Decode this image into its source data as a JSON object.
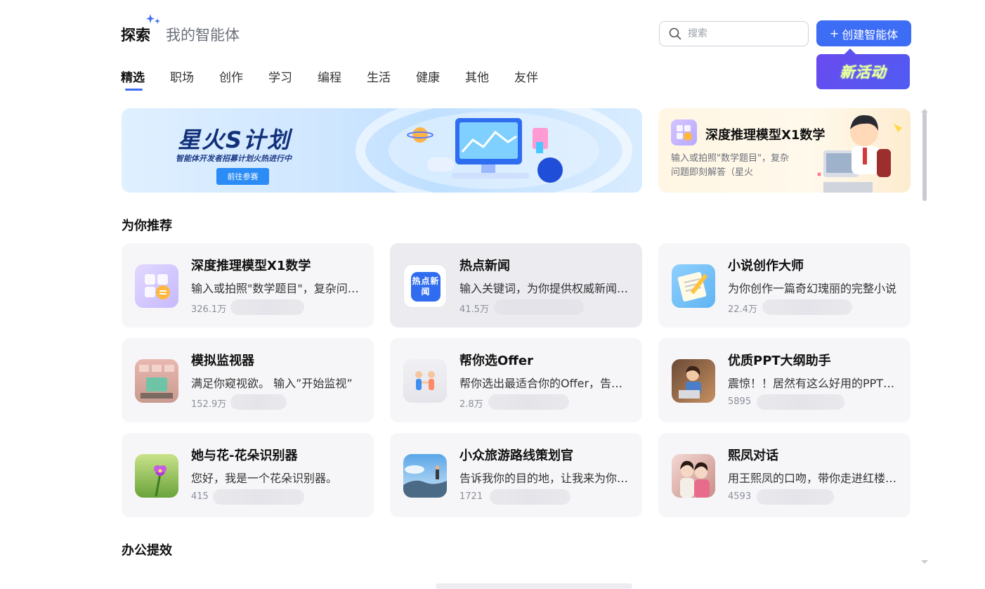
{
  "header": {
    "title": "探索",
    "subtitle": "我的智能体",
    "search_placeholder": "搜索",
    "create_button": "创建智能体",
    "create_plus": "+",
    "new_activity": "新活动"
  },
  "tabs": [
    "精选",
    "职场",
    "创作",
    "学习",
    "编程",
    "生活",
    "健康",
    "其他",
    "友伴"
  ],
  "banner_main": {
    "title": "星火S计划",
    "subtitle": "智能体开发者招募计划火热进行中",
    "button": "前往参赛"
  },
  "banner_side": {
    "title": "深度推理模型X1数学",
    "desc": "输入或拍照\"数学题目\"，复杂问题即刻解答（星火"
  },
  "sections": {
    "recommend": "为你推荐",
    "office": "办公提效"
  },
  "cards": [
    {
      "name": "深度推理模型X1数学",
      "desc": "输入或拍照\"数学题目\"，复杂问题即刻解答",
      "count": "326.1万",
      "icon": "math-icon"
    },
    {
      "name": "热点新闻",
      "desc": "输入关键词，为你提供权威新闻资讯",
      "count": "41.5万",
      "icon": "news-icon",
      "icon_text": "热点新闻"
    },
    {
      "name": "小说创作大师",
      "desc": "为你创作一篇奇幻瑰丽的完整小说",
      "count": "22.4万",
      "icon": "notepad-icon"
    },
    {
      "name": "模拟监视器",
      "desc": "满足你窥视欲。 输入”开始监视”",
      "count": "152.9万",
      "icon": "monitor-room-icon"
    },
    {
      "name": "帮你选Offer",
      "desc": "帮你选出最适合你的Offer，告诉你答案",
      "count": "2.8万",
      "icon": "handshake-icon"
    },
    {
      "name": "优质PPT大纲助手",
      "desc": "震惊！！居然有这么好用的PPT大纲助手",
      "count": "5895",
      "icon": "girl-laptop-icon"
    },
    {
      "name": "她与花-花朵识别器",
      "desc": "您好，我是一个花朵识别器。",
      "count": "415",
      "icon": "flower-icon"
    },
    {
      "name": "小众旅游路线策划官",
      "desc": "告诉我你的目的地，让我来为你策划路线",
      "count": "1721",
      "icon": "travel-icon"
    },
    {
      "name": "熙凤对话",
      "desc": "用王熙凤的口吻，带你走进红楼梦的世界",
      "count": "4593",
      "icon": "ladies-icon"
    }
  ]
}
